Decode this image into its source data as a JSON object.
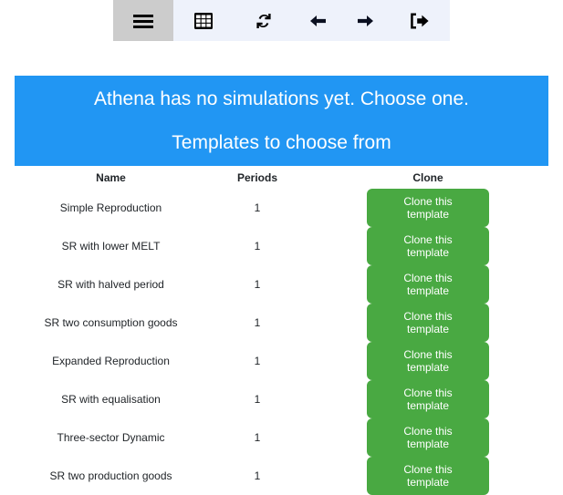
{
  "colors": {
    "toolbar_bg": "#eef2fb",
    "toolbar_active_bg": "#cccccc",
    "banner_bg": "#2196f3",
    "banner_text": "#ffffff",
    "clone_button_bg": "#49a942",
    "text": "#212529"
  },
  "toolbar": {
    "buttons": [
      {
        "name": "hamburger-menu",
        "icon": "hamburger-icon",
        "label": "Menu",
        "active": true
      },
      {
        "name": "grid-view",
        "icon": "grid-icon",
        "label": "Grid",
        "active": false
      },
      {
        "name": "refresh",
        "icon": "refresh-icon",
        "label": "Refresh",
        "active": false
      },
      {
        "name": "back",
        "icon": "arrow-left-icon",
        "label": "Back",
        "active": false
      },
      {
        "name": "forward",
        "icon": "arrow-right-icon",
        "label": "Forward",
        "active": false
      },
      {
        "name": "logout",
        "icon": "sign-out-icon",
        "label": "Log out",
        "active": false
      }
    ]
  },
  "banner": {
    "line1": "Athena has no simulations yet. Choose one.",
    "line2": "Templates to choose from"
  },
  "table": {
    "headers": [
      "Name",
      "Periods",
      "Clone"
    ],
    "clone_button_label": "Clone this template",
    "rows": [
      {
        "name": "Simple Reproduction",
        "periods": "1"
      },
      {
        "name": "SR with lower MELT",
        "periods": "1"
      },
      {
        "name": "SR with halved period",
        "periods": "1"
      },
      {
        "name": "SR two consumption goods",
        "periods": "1"
      },
      {
        "name": "Expanded Reproduction",
        "periods": "1"
      },
      {
        "name": "SR with equalisation",
        "periods": "1"
      },
      {
        "name": "Three-sector Dynamic",
        "periods": "1"
      },
      {
        "name": "SR two production goods",
        "periods": "1"
      }
    ]
  }
}
